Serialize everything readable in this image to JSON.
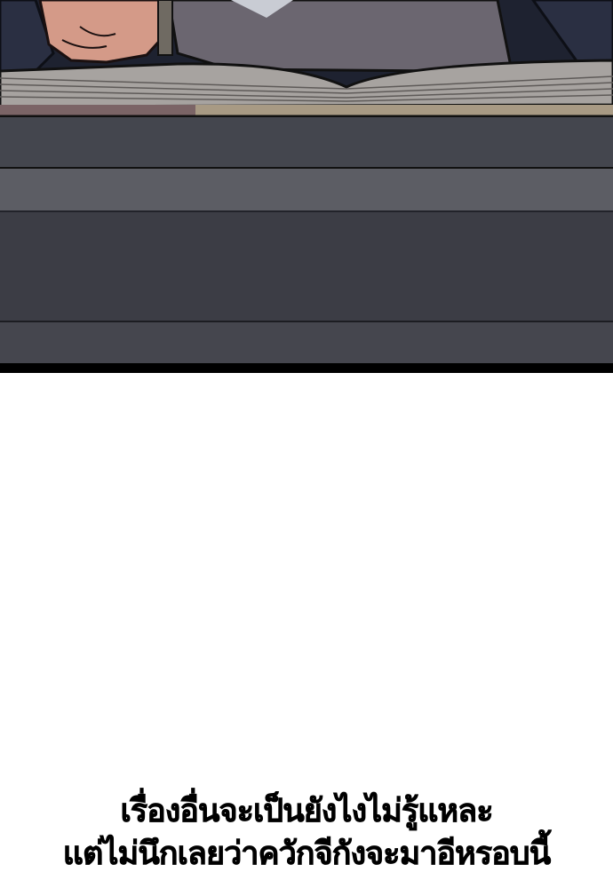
{
  "caption": {
    "line1": "เรื่องอื่นจะเป็นยังไงไม่รู้แหละ",
    "line2": "แต่ไม่นึกเลยว่าควักจีกังจะมาอีหรอบนี้"
  }
}
